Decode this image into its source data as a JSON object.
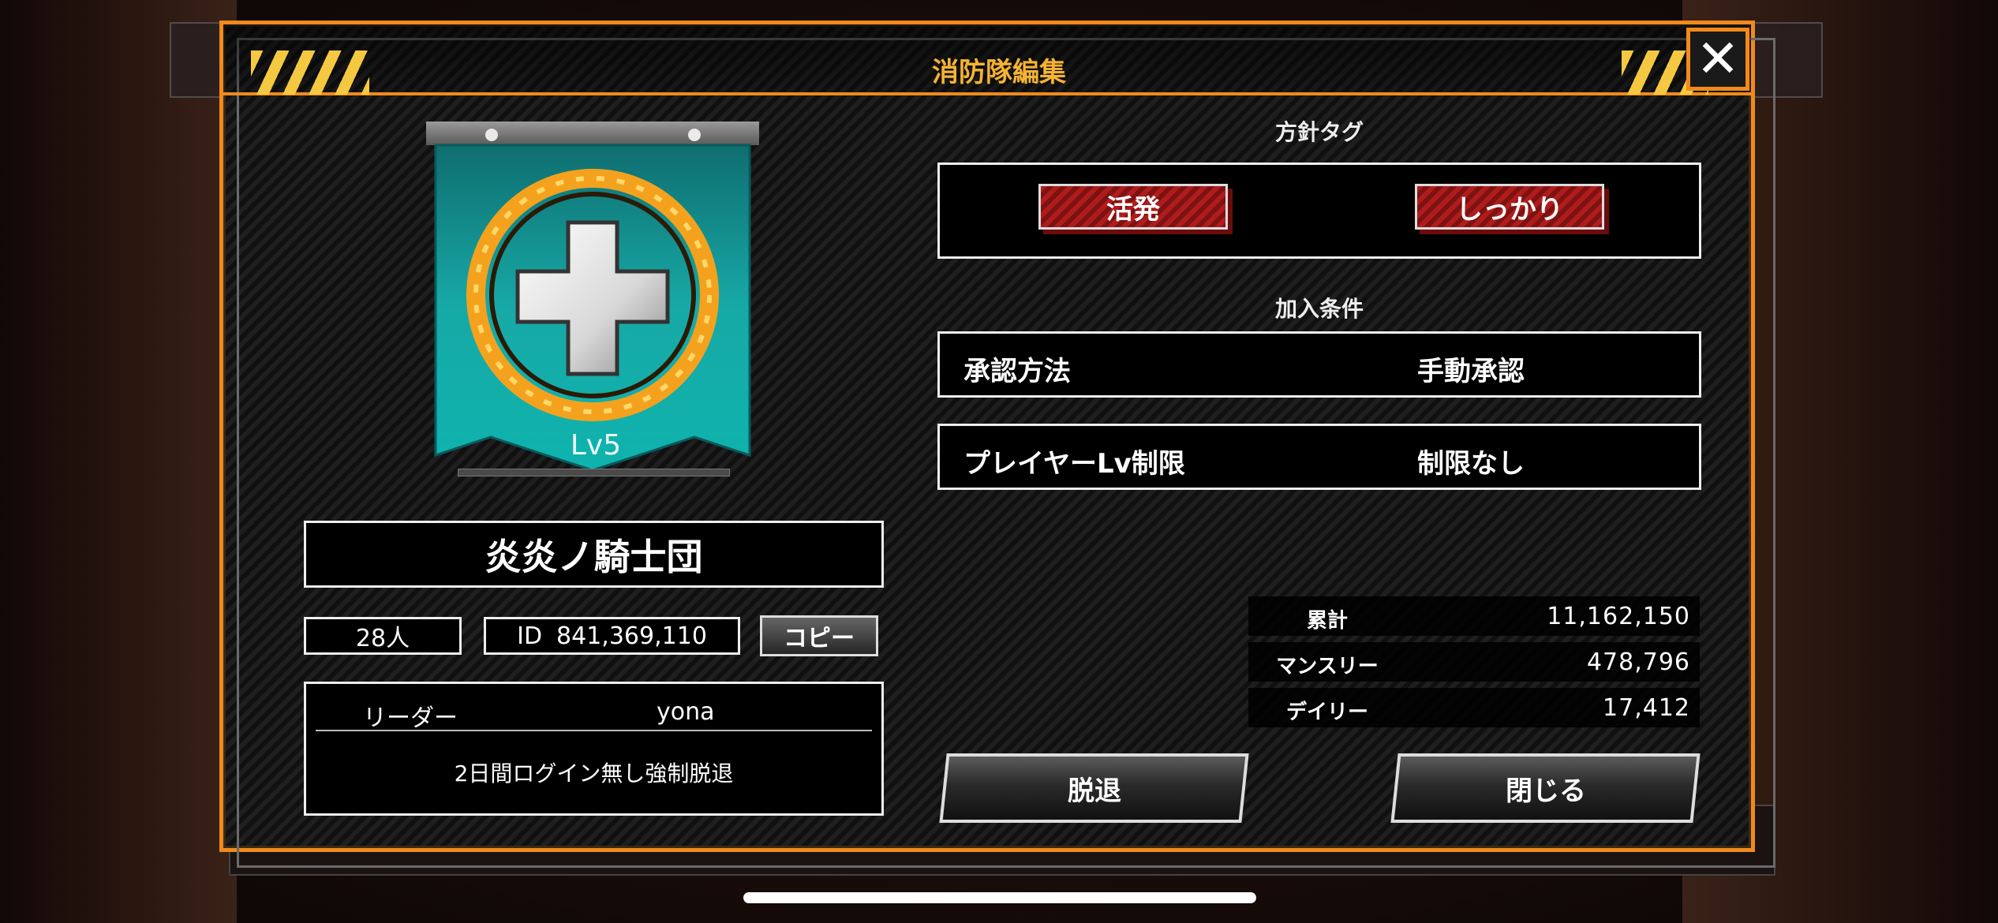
{
  "header": {
    "title": "消防隊編集",
    "close_icon": "close-x-icon"
  },
  "emblem": {
    "level": "Lv5",
    "icon": "cross-flame-emblem-icon",
    "colors": {
      "banner": "#16a6a3",
      "flame": "#f4a21e"
    }
  },
  "team": {
    "name": "炎炎ノ騎士団",
    "members": "28人",
    "id_label": "ID",
    "id_value": "841,369,110",
    "copy_label": "コピー",
    "leader_label": "リーダー",
    "leader_value": "yona",
    "rule_note": "2日間ログイン無し強制脱退"
  },
  "policy": {
    "title": "方針タグ",
    "tags": [
      "活発",
      "しっかり"
    ]
  },
  "join_conditions": {
    "title": "加入条件",
    "rows": [
      {
        "label": "承認方法",
        "value": "手動承認"
      },
      {
        "label": "プレイヤーLv制限",
        "value": "制限なし"
      }
    ]
  },
  "stats": [
    {
      "label": "累計",
      "value": "11,162,150"
    },
    {
      "label": "マンスリー",
      "value": "478,796"
    },
    {
      "label": "デイリー",
      "value": "17,412"
    }
  ],
  "actions": {
    "withdraw": "脱退",
    "close": "閉じる"
  },
  "colors": {
    "accent": "#f08a1c",
    "title": "#f6b333",
    "tag": "#b01c1c"
  }
}
